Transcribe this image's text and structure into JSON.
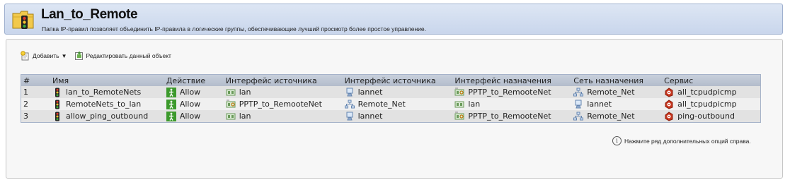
{
  "header": {
    "title": "Lan_to_Remote",
    "subtitle": "Папка IP-правил позволяет объединить IP-правила в логические группы, обеспечивающие лучший просмотр более простое управление."
  },
  "toolbar": {
    "add_label": "Добавить",
    "edit_label": "Редактировать данный объект"
  },
  "table": {
    "columns": [
      "#",
      "Имя",
      "Действие",
      "Интерфейс источника",
      "Интерфейс источника",
      "Интерфейс назначения",
      "Сеть назначения",
      "Сервис"
    ],
    "rows": [
      {
        "num": "1",
        "name": "lan_to_RemoteNets",
        "action": "Allow",
        "src_if": "lan",
        "src_if_icon": "interface-icon",
        "src_net": "lannet",
        "src_net_icon": "host-icon",
        "dst_if": "PPTP_to_RemooteNet",
        "dst_if_icon": "vpn-interface-icon",
        "dst_net": "Remote_Net",
        "dst_net_icon": "network-icon",
        "service": "all_tcpudpicmp"
      },
      {
        "num": "2",
        "name": "RemoteNets_to_lan",
        "action": "Allow",
        "src_if": "PPTP_to_RemooteNet",
        "src_if_icon": "vpn-interface-icon",
        "src_net": "Remote_Net",
        "src_net_icon": "network-icon",
        "dst_if": "lan",
        "dst_if_icon": "interface-icon",
        "dst_net": "lannet",
        "dst_net_icon": "host-icon",
        "service": "all_tcpudpicmp"
      },
      {
        "num": "3",
        "name": "allow_ping_outbound",
        "action": "Allow",
        "src_if": "lan",
        "src_if_icon": "interface-icon",
        "src_net": "lannet",
        "src_net_icon": "host-icon",
        "dst_if": "PPTP_to_RemooteNet",
        "dst_if_icon": "vpn-interface-icon",
        "dst_net": "Remote_Net",
        "dst_net_icon": "network-icon",
        "service": "ping-outbound"
      }
    ]
  },
  "help": {
    "text": "Нажмите ряд дополнительных опций справа."
  },
  "colors": {
    "allow_green": "#3c9a2c",
    "header_blue": "#c9d6ec",
    "service_red": "#c8361e"
  }
}
